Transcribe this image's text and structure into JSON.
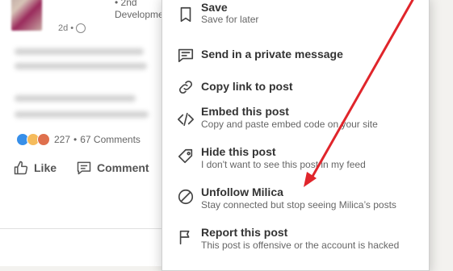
{
  "post": {
    "author_degree": "• 2nd",
    "author_headline": "Development",
    "time": "2d •",
    "reactions_count": "227",
    "comments_count": "67 Comments",
    "separator": "•",
    "actions": {
      "like": "Like",
      "comment": "Comment"
    },
    "reaction_icons": [
      "like-reaction-icon",
      "idea-reaction-icon",
      "love-reaction-icon"
    ]
  },
  "menu": {
    "items": [
      {
        "title": "Save",
        "subtitle": "Save for later",
        "icon": "bookmark-icon"
      },
      {
        "title": "Send in a private message",
        "subtitle": "",
        "icon": "message-icon"
      },
      {
        "title": "Copy link to post",
        "subtitle": "",
        "icon": "link-icon"
      },
      {
        "title": "Embed this post",
        "subtitle": "Copy and paste embed code on your site",
        "icon": "code-icon"
      },
      {
        "title": "Hide this post",
        "subtitle": "I don't want to see this post in my feed",
        "icon": "tag-icon"
      },
      {
        "title": "Unfollow Milica",
        "subtitle": "Stay connected but stop seeing Milica’s posts",
        "icon": "block-icon"
      },
      {
        "title": "Report this post",
        "subtitle": "This post is offensive or the account is hacked",
        "icon": "flag-icon"
      }
    ]
  },
  "colors": {
    "annotation_arrow": "#e0252b",
    "menu_text": "#333333",
    "menu_subtext": "#666666",
    "like_blue": "#378fe9"
  }
}
